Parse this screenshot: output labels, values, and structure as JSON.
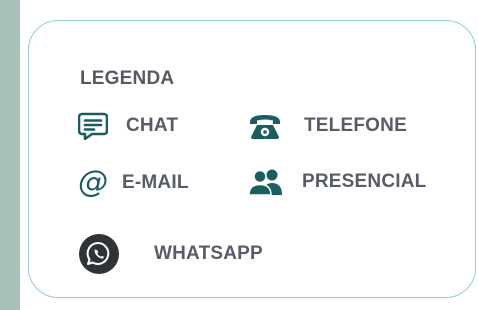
{
  "legend": {
    "title": "LEGENDA",
    "items": [
      {
        "label": "CHAT",
        "icon": "chat-icon"
      },
      {
        "label": "TELEFONE",
        "icon": "telephone-icon"
      },
      {
        "label": "E-MAIL",
        "icon": "at-sign-icon",
        "symbol": "@"
      },
      {
        "label": "PRESENCIAL",
        "icon": "people-icon"
      },
      {
        "label": "WHATSAPP",
        "icon": "whatsapp-icon"
      }
    ]
  },
  "colors": {
    "background": "#a9c1b7",
    "card_border": "#8fd0cf",
    "icon_teal": "#1a5e62",
    "text": "#575c66",
    "whatsapp_circle": "#2f3236"
  }
}
